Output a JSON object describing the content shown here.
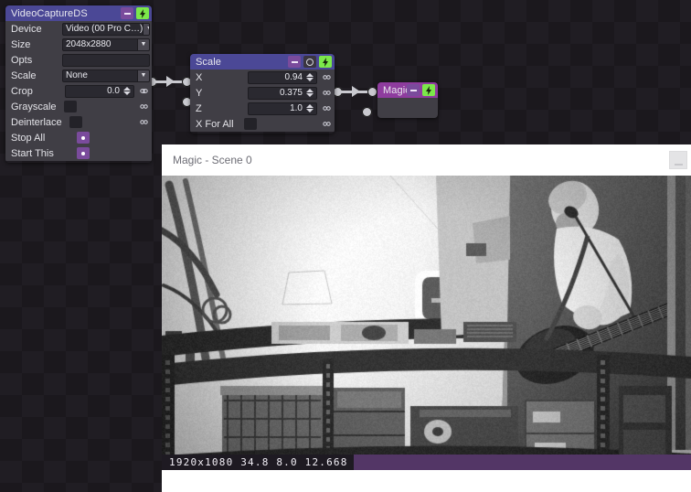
{
  "canvas": {
    "background_color": "#1b181d",
    "grid_color": "#201d23"
  },
  "nodes": [
    {
      "id": "videocapture",
      "title": "VideoCaptureDS",
      "header_color": "#4b4896",
      "body_color": "#403e45",
      "buttons": [
        {
          "name": "minimize-button",
          "icon": "minus-icon"
        },
        {
          "name": "enable-button",
          "icon": "lightning-bolt-icon"
        }
      ],
      "rows": [
        {
          "label": "Device",
          "type": "combo",
          "value": "Video (00 Pro C…)"
        },
        {
          "label": "Size",
          "type": "combo",
          "value": "2048x2880"
        },
        {
          "label": "Opts",
          "type": "text",
          "value": ""
        },
        {
          "label": "Scale",
          "type": "combo",
          "value": "None"
        },
        {
          "label": "Crop",
          "type": "number",
          "value": "0.0",
          "link": true
        },
        {
          "label": "Grayscale",
          "type": "checkbox",
          "value": false,
          "link": true
        },
        {
          "label": "Deinterlace",
          "type": "checkbox",
          "value": false,
          "link": true
        },
        {
          "label": "Stop All",
          "type": "button",
          "value": ""
        },
        {
          "label": "Start This",
          "type": "button",
          "value": ""
        }
      ]
    },
    {
      "id": "scale",
      "title": "Scale",
      "header_color": "#4b4896",
      "body_color": "#403e45",
      "buttons": [
        {
          "name": "minimize-button",
          "icon": "minus-icon"
        },
        {
          "name": "hold-button",
          "icon": "clock-icon"
        },
        {
          "name": "enable-button",
          "icon": "lightning-bolt-icon"
        }
      ],
      "rows": [
        {
          "label": "X",
          "type": "number",
          "value": "0.94",
          "link": true
        },
        {
          "label": "Y",
          "type": "number",
          "value": "0.375",
          "link": true
        },
        {
          "label": "Z",
          "type": "number",
          "value": "1.0",
          "link": true
        },
        {
          "label": "X For All",
          "type": "checkbox",
          "value": false,
          "link": true
        }
      ]
    },
    {
      "id": "magic",
      "title": "Magic",
      "header_color": "#8e3c9e",
      "body_color": "#403e45",
      "buttons": [
        {
          "name": "minimize-button",
          "icon": "minus-icon"
        },
        {
          "name": "enable-button",
          "icon": "lightning-bolt-icon"
        }
      ],
      "rows": []
    }
  ],
  "scene_window": {
    "title": "Magic - Scene 0",
    "minimize_label": "",
    "status": {
      "resolution": "1920x1080",
      "fps": "34.8",
      "value_a": "8.0",
      "value_b": "12.668",
      "full_text": "1920x1080 34.8 8.0 12.668",
      "bar_color": "#533666"
    }
  }
}
